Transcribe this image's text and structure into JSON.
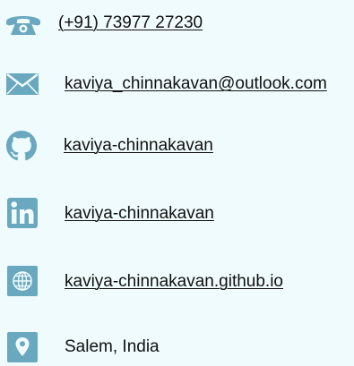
{
  "theme": {
    "background": "#f0fbfd",
    "icon_color": "#6aa8bf",
    "text_color": "#111111"
  },
  "contacts": [
    {
      "icon": "phone-icon",
      "text": "(+91) 73977 27230"
    },
    {
      "icon": "mail-icon",
      "text": "kaviya_chinnakavan@outlook.com"
    },
    {
      "icon": "github-icon",
      "text": "kaviya-chinnakavan"
    },
    {
      "icon": "linkedin-icon",
      "text": "kaviya-chinnakavan"
    },
    {
      "icon": "globe-icon",
      "text": "kaviya-chinnakavan.github.io"
    },
    {
      "icon": "location-pin-icon",
      "text": "Salem, India"
    }
  ]
}
